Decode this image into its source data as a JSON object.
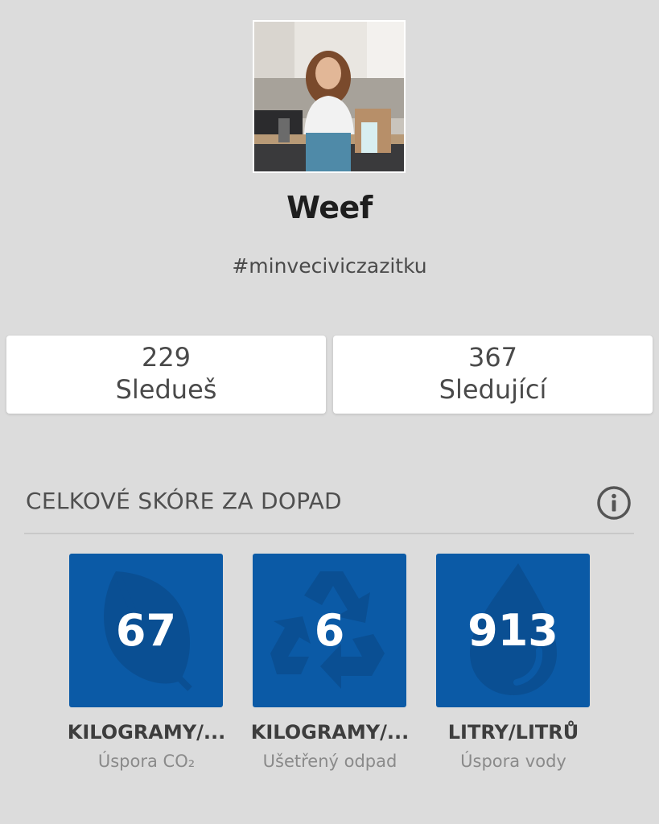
{
  "profile": {
    "name": "Weef",
    "hashtag": "#minveciviczazitku"
  },
  "stats": [
    {
      "value": "229",
      "label": "Sledueš"
    },
    {
      "value": "367",
      "label": "Sledující"
    }
  ],
  "impact": {
    "title": "CELKOVÉ SKÓRE ZA DOPAD",
    "info_icon": "info-circle-icon",
    "tiles": [
      {
        "value": "67",
        "unit": "KILOGRAMY/...",
        "desc": "Úspora CO₂",
        "icon": "leaf-icon"
      },
      {
        "value": "6",
        "unit": "KILOGRAMY/...",
        "desc": "Ušetřený odpad",
        "icon": "recycle-icon"
      },
      {
        "value": "913",
        "unit": "LITRY/LITRŮ",
        "desc": "Úspora vody",
        "icon": "water-drop-icon"
      }
    ]
  },
  "colors": {
    "background": "#dcdcdc",
    "tile": "#0b5aa6",
    "card": "#ffffff"
  }
}
